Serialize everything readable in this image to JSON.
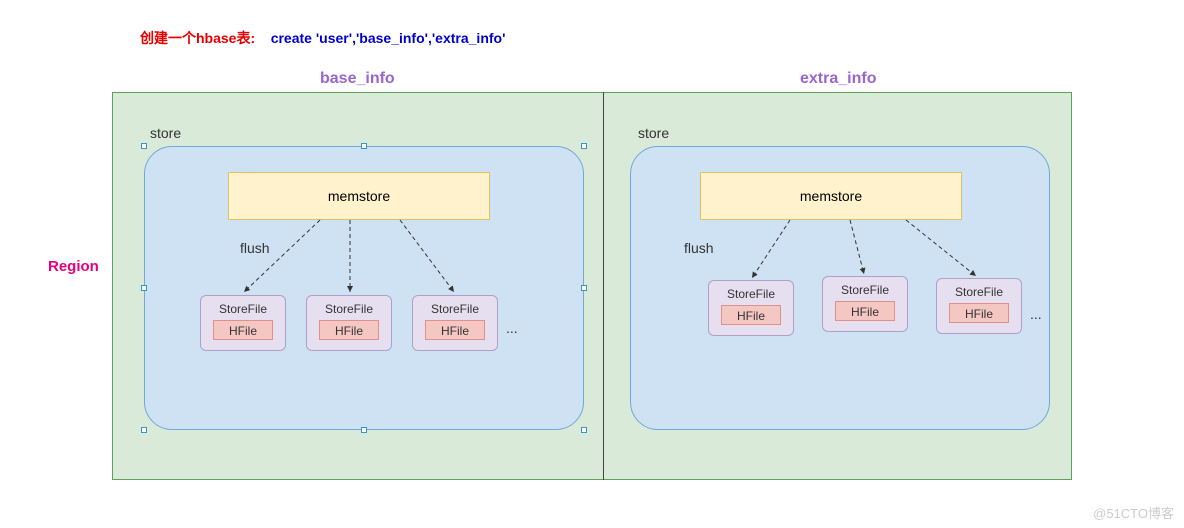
{
  "header": {
    "prompt_cn": "创建一个hbase表:",
    "command": "create  'user','base_info','extra_info'"
  },
  "column_families": {
    "left": "base_info",
    "right": "extra_info"
  },
  "region_label": "Region",
  "store_label": "store",
  "memstore_label": "memstore",
  "flush_label": "flush",
  "storefiles": {
    "left": [
      {
        "title": "StoreFile",
        "hfile": "HFile"
      },
      {
        "title": "StoreFile",
        "hfile": "HFile"
      },
      {
        "title": "StoreFile",
        "hfile": "HFile"
      }
    ],
    "right": [
      {
        "title": "StoreFile",
        "hfile": "HFile"
      },
      {
        "title": "StoreFile",
        "hfile": "HFile"
      },
      {
        "title": "StoreFile",
        "hfile": "HFile"
      }
    ],
    "ellipsis": "..."
  },
  "watermark": "@51CTO博客"
}
